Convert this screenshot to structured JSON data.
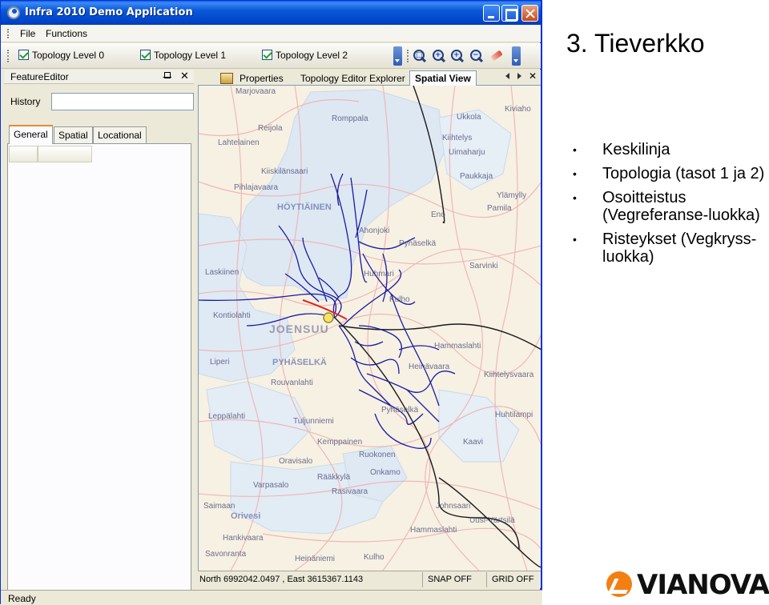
{
  "window": {
    "title": "Infra 2010 Demo Application"
  },
  "menu": {
    "file": "File",
    "functions": "Functions"
  },
  "toolbar": {
    "layers": [
      {
        "label": "Topology Level 0",
        "checked": true
      },
      {
        "label": "Topology Level 1",
        "checked": true
      },
      {
        "label": "Topology Level 2",
        "checked": true
      }
    ],
    "tools": [
      "zoom-box-icon",
      "zoom-in-icon",
      "zoom-in-icon",
      "zoom-out-icon",
      "eraser-icon"
    ]
  },
  "feature_editor": {
    "title": "FeatureEditor",
    "history_label": "History",
    "history_value": "",
    "tabs": [
      "General",
      "Spatial",
      "Locational"
    ],
    "active_tab": "General"
  },
  "documents": {
    "tabs": [
      "Properties",
      "Topology Editor Explorer",
      "Spatial View"
    ],
    "active": "Spatial View"
  },
  "map": {
    "places": [
      "Marjovaara",
      "Romppala",
      "Ukkola",
      "Kiviaho",
      "Reijola",
      "Lahtelainen",
      "Kiihtelys",
      "Uimaharju",
      "Paukkaja",
      "Kiiskilänsaari",
      "Pihlajavaara",
      "HÖYTIÄINEN",
      "Ylämylly",
      "Eno",
      "Pamila",
      "Ahonjoki",
      "Pyhäselkä",
      "Laskiinen",
      "Sarvinki",
      "Huhmari",
      "Kulho",
      "Kontiolahti",
      "Hammaslahti",
      "JOENSUU",
      "PYHÄSELKÄ",
      "Heinävaara",
      "Liperi",
      "Rouvanlahti",
      "Kiihtelysvaara",
      "Leppälahti",
      "Tuljunniemi",
      "Pyhäselkä",
      "Huhtilampi",
      "Kemppainen",
      "Kaavi",
      "Ruokonen",
      "Oravisalo",
      "Rääkkylä",
      "Varpasalo",
      "Rasivaara",
      "Onkamo",
      "Saimaan",
      "Johnsaari",
      "Orivesi",
      "Uusi-Värtsilä",
      "Hammaslahti",
      "Hankivaara",
      "Savonranta",
      "Heinäniemi",
      "Kulho"
    ],
    "colors": {
      "land": "#f6f1e3",
      "water": "#d9e6f2",
      "road": "#f0b1b1",
      "route_level1": "#1a1aa0",
      "route_level0": "#000000"
    }
  },
  "map_status": {
    "coords": "North 6992042.0497 , East 3615367.1143",
    "snap": "SNAP OFF",
    "grid": "GRID OFF"
  },
  "status": "Ready",
  "slide": {
    "title": "3. Tieverkko",
    "bullets": [
      "Keskilinja",
      "Topologia (tasot 1 ja 2)",
      "Osoitteistus (Vegreferanse-luokka)",
      "Risteykset (Vegkryss-luokka)"
    ],
    "logo_text": "VIANOVA",
    "logo_color": "#f27f12"
  }
}
